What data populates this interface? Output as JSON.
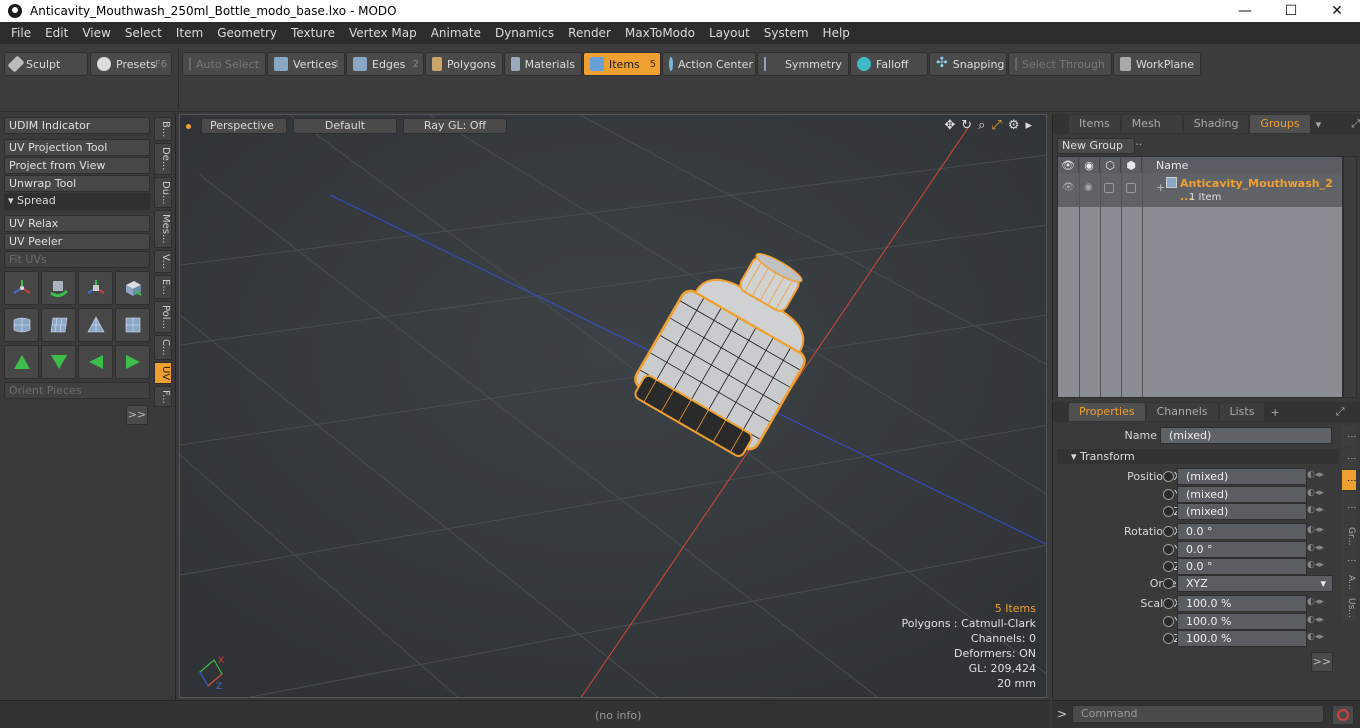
{
  "window": {
    "title": "Anticavity_Mouthwash_250ml_Bottle_modo_base.lxo - MODO",
    "minimize": "—",
    "maximize": "☐",
    "close": "✕"
  },
  "menu": [
    "File",
    "Edit",
    "View",
    "Select",
    "Item",
    "Geometry",
    "Texture",
    "Vertex Map",
    "Animate",
    "Dynamics",
    "Render",
    "MaxToModo",
    "Layout",
    "System",
    "Help"
  ],
  "toolbar": {
    "sculpt": "Sculpt",
    "presets": "Presets",
    "presets_key": "F6",
    "auto_select": "Auto Select",
    "vertices": "Vertices",
    "vertices_num": "1",
    "edges": "Edges",
    "edges_num": "2",
    "polygons": "Polygons",
    "materials": "Materials",
    "items": "Items",
    "items_num": "5",
    "action_center": "Action Center",
    "symmetry": "Symmetry",
    "falloff": "Falloff",
    "snapping": "Snapping",
    "select_through": "Select Through",
    "workplane": "WorkPlane"
  },
  "left_panel": {
    "tools": [
      "UDIM Indicator",
      "UV Projection Tool",
      "Project from View",
      "Unwrap Tool"
    ],
    "spread": "Spread",
    "tools2": [
      "UV Relax",
      "UV Peeler"
    ],
    "fit_uvs": "Fit UVs",
    "orient_pieces": "Orient Pieces",
    "more": ">>",
    "vtabs": [
      "B...",
      "De...",
      "Du...",
      "Mes...",
      "V...",
      "E...",
      "Pol...",
      "C...",
      "UV",
      "F..."
    ]
  },
  "viewport": {
    "view": "Perspective",
    "shading": "Default",
    "raygl": "Ray GL: Off",
    "axis_x": "X",
    "axis_z": "Z",
    "info": {
      "items": "5 Items",
      "polygons": "Polygons : Catmull-Clark",
      "channels": "Channels: 0",
      "deformers": "Deformers: ON",
      "gl": "GL: 209,424",
      "scale": "20 mm"
    }
  },
  "status": {
    "text": "(no info)"
  },
  "groups_panel": {
    "tabs": [
      "Items",
      "Mesh ...",
      "Shading",
      "Groups"
    ],
    "new_group": "New Group",
    "name_col": "Name",
    "row_name": "Anticavity_Mouthwash_2 ...",
    "row_sub": "1 Item"
  },
  "properties": {
    "tabs": [
      "Properties",
      "Channels",
      "Lists"
    ],
    "add": "+",
    "name_label": "Name",
    "name_value": "(mixed)",
    "transform": "Transform",
    "rows": [
      {
        "label": "Position X",
        "value": "(mixed)"
      },
      {
        "label": "Y",
        "value": "(mixed)"
      },
      {
        "label": "Z",
        "value": "(mixed)"
      },
      {
        "label": "Rotation X",
        "value": "0.0 °"
      },
      {
        "label": "Y",
        "value": "0.0 °"
      },
      {
        "label": "Z",
        "value": "0.0 °"
      },
      {
        "label": "Order",
        "value": "XYZ"
      },
      {
        "label": "Scale X",
        "value": "100.0 %"
      },
      {
        "label": "Y",
        "value": "100.0 %"
      },
      {
        "label": "Z",
        "value": "100.0 %"
      }
    ],
    "more": ">>",
    "vtabs": [
      "Gr...",
      "A...",
      "Us..."
    ]
  },
  "command": {
    "prompt": ">",
    "placeholder": "Command"
  },
  "colors": {
    "accent": "#f0a030",
    "viewport_bg": "#353a3d",
    "axis_x": "#d0483a",
    "axis_z": "#3a4ad0"
  }
}
